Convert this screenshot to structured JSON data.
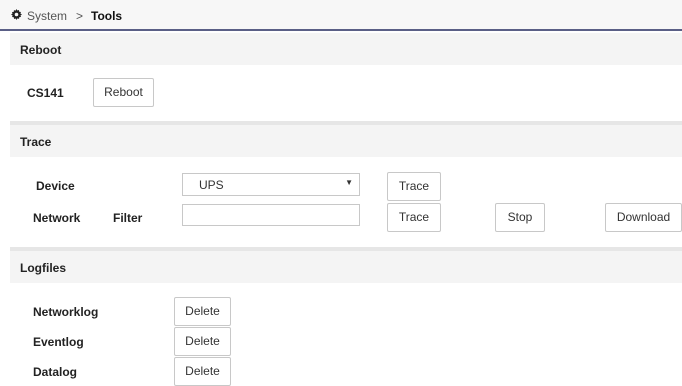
{
  "breadcrumb": {
    "root": "System",
    "separator": ">",
    "current": "Tools"
  },
  "reboot": {
    "title": "Reboot",
    "device_label": "CS141",
    "button_label": "Reboot"
  },
  "trace": {
    "title": "Trace",
    "device_label": "Device",
    "device_selected": "UPS",
    "device_trace_label": "Trace",
    "network_label": "Network",
    "filter_label": "Filter",
    "filter_value": "",
    "network_trace_label": "Trace",
    "stop_label": "Stop",
    "download_label": "Download"
  },
  "logfiles": {
    "title": "Logfiles",
    "items": [
      {
        "label": "Networklog",
        "action": "Delete"
      },
      {
        "label": "Eventlog",
        "action": "Delete"
      },
      {
        "label": "Datalog",
        "action": "Delete"
      }
    ]
  }
}
